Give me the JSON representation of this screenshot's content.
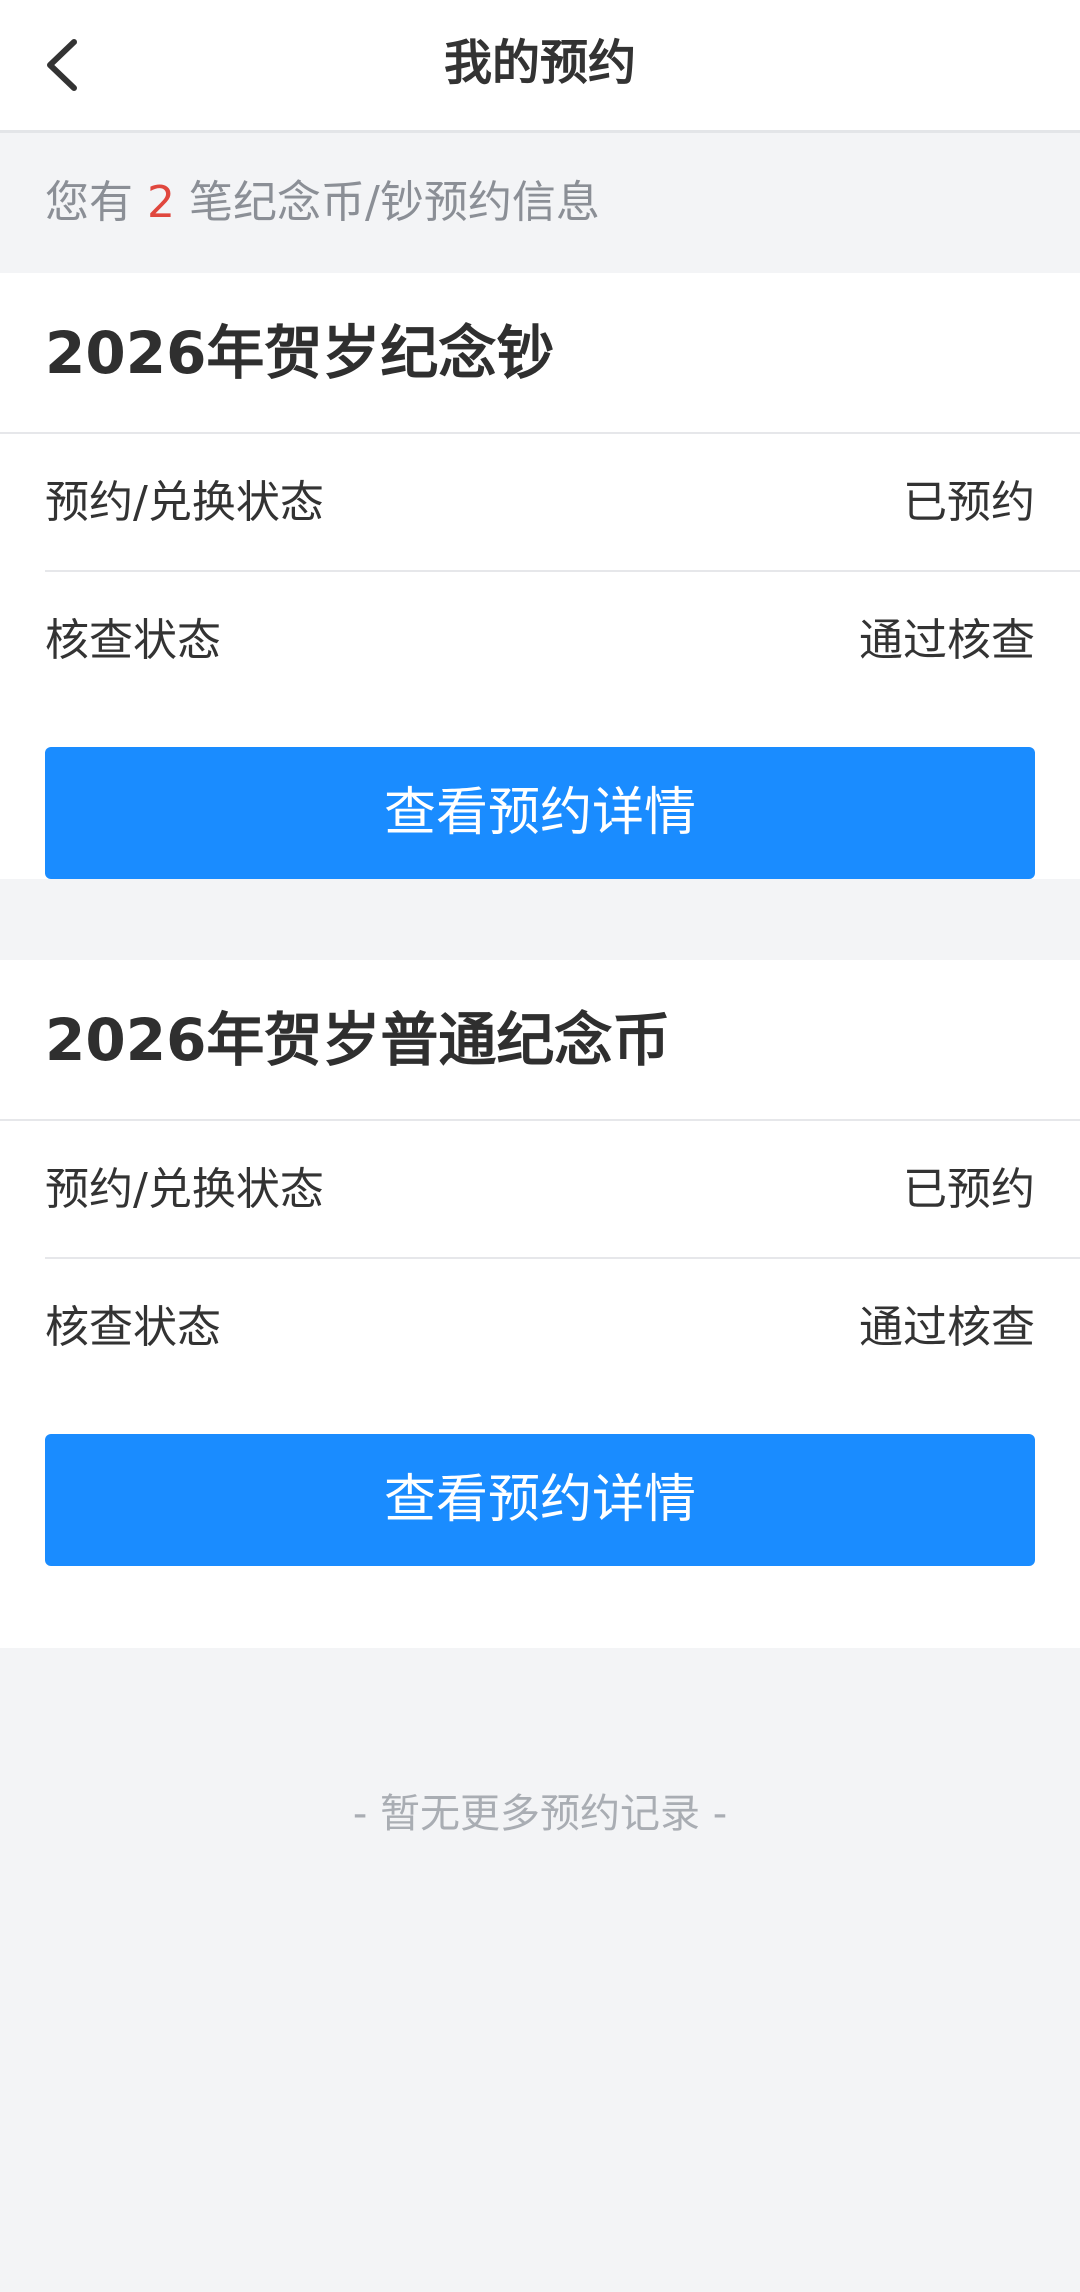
{
  "header": {
    "title": "我的预约",
    "back_icon": "chevron-left-icon"
  },
  "summary": {
    "prefix": "您有",
    "count": "2",
    "suffix": "笔纪念币/钞预约信息"
  },
  "reservations": [
    {
      "name": "2026年贺岁纪念钞",
      "status_label": "预约/兑换状态",
      "status_value": "已预约",
      "check_label": "核查状态",
      "check_value": "通过核查",
      "button_label": "查看预约详情"
    },
    {
      "name": "2026年贺岁普通纪念币",
      "status_label": "预约/兑换状态",
      "status_value": "已预约",
      "check_label": "核查状态",
      "check_value": "通过核查",
      "button_label": "查看预约详情"
    }
  ],
  "footer": {
    "text": "- 暂无更多预约记录 -"
  },
  "colors": {
    "accent": "#1a8cff",
    "count_highlight": "#e0473e",
    "background": "#f3f4f6"
  }
}
